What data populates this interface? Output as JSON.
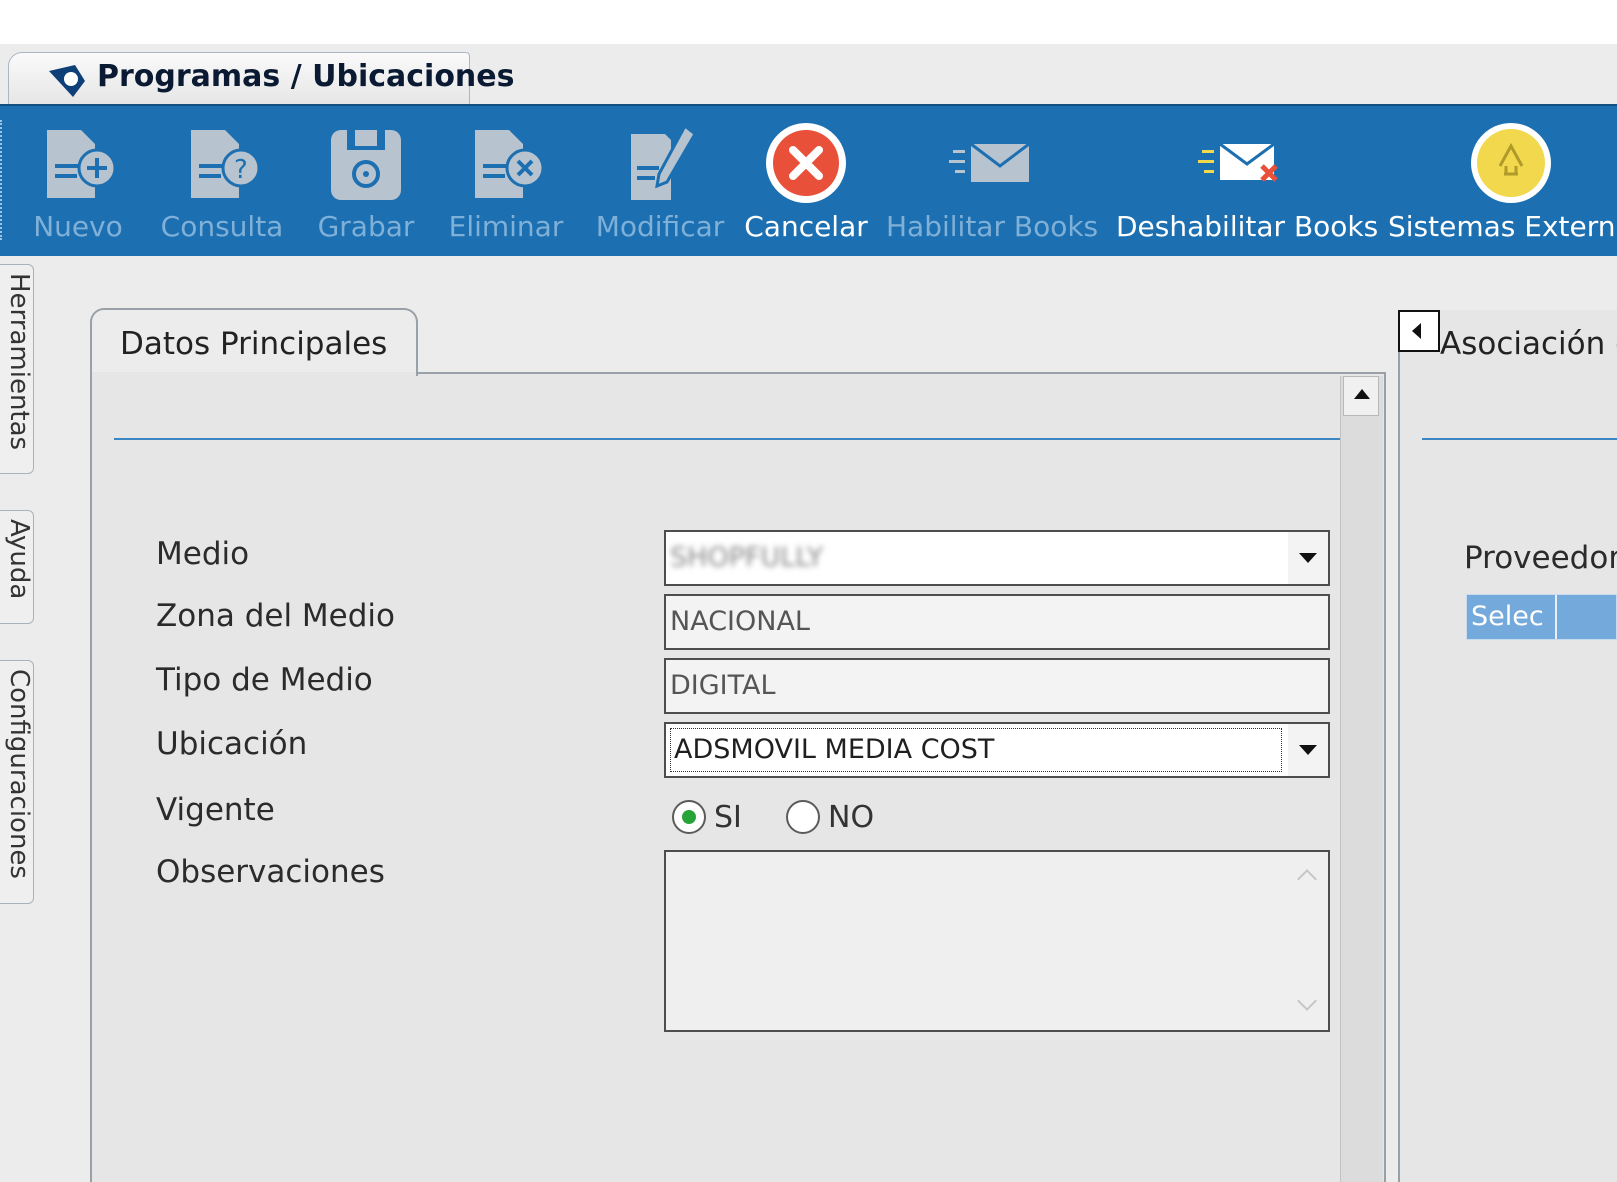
{
  "window": {
    "tab_title": "Programas / Ubicaciones"
  },
  "toolbar": {
    "buttons": [
      {
        "label": "Nuevo",
        "icon": "document-add-icon",
        "enabled": false
      },
      {
        "label": "Consulta",
        "icon": "document-question-icon",
        "enabled": false
      },
      {
        "label": "Grabar",
        "icon": "floppy-disk-icon",
        "enabled": false
      },
      {
        "label": "Eliminar",
        "icon": "document-delete-icon",
        "enabled": false
      },
      {
        "label": "Modificar",
        "icon": "document-edit-icon",
        "enabled": false
      },
      {
        "label": "Cancelar",
        "icon": "cancel-x-icon",
        "enabled": true
      },
      {
        "label": "Habilitar Books",
        "icon": "envelope-icon",
        "enabled": false
      },
      {
        "label": "Deshabilitar Books",
        "icon": "envelope-x-icon",
        "enabled": true
      },
      {
        "label": "Sistemas Externo",
        "icon": "external-systems-icon",
        "enabled": true
      }
    ]
  },
  "sidetabs": [
    "Herramientas",
    "Ayuda",
    "Configuraciones"
  ],
  "main": {
    "tab_label": "Datos Principales",
    "fields": {
      "medio_label": "Medio",
      "medio_value": "SHOPFULLY",
      "zona_label": "Zona del Medio",
      "zona_value": "NACIONAL",
      "tipo_label": "Tipo de Medio",
      "tipo_value": "DIGITAL",
      "ubicacion_label": "Ubicación",
      "ubicacion_value": "ADSMOVIL MEDIA COST",
      "vigente_label": "Vigente",
      "vigente_si": "SI",
      "vigente_no": "NO",
      "vigente_selected": "SI",
      "observaciones_label": "Observaciones",
      "observaciones_value": ""
    }
  },
  "right_panel": {
    "title": "Asociación c",
    "proveedor_label": "Proveedor",
    "grid_header_col1": "Selec"
  },
  "colors": {
    "toolbar_bg": "#1c6fb1",
    "accent_rule": "#3d86c4",
    "radio_selected": "#27a33a",
    "cancel_red": "#e8503a",
    "external_yellow": "#f2d84c"
  }
}
